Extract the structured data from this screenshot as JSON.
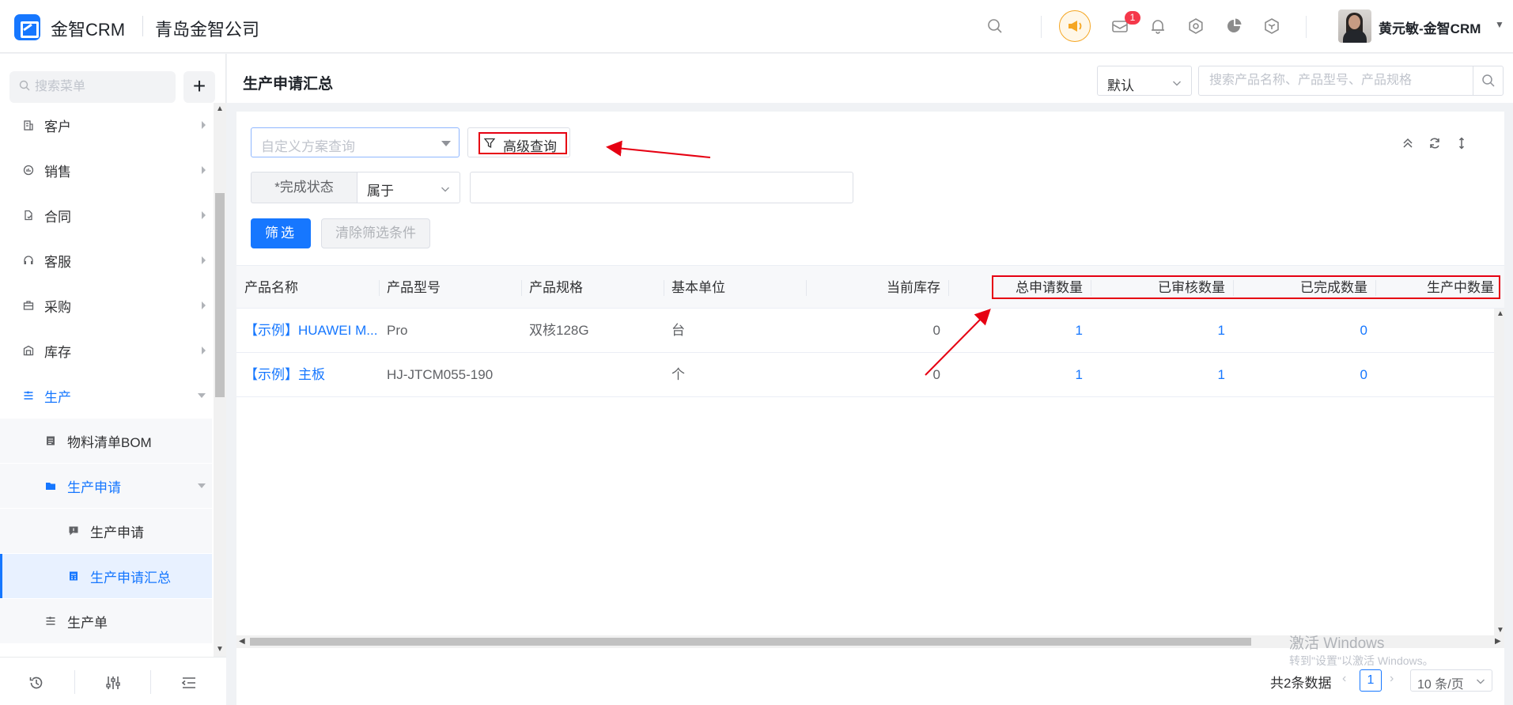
{
  "header": {
    "brand": "金智CRM",
    "company": "青岛金智公司",
    "message_badge": "1",
    "username": "黄元敏-金智CRM",
    "icons": [
      "search-icon",
      "speaker-icon",
      "message-icon",
      "bell-icon",
      "gear-icon",
      "pie-chart-icon",
      "cube-icon",
      "caret-down-icon"
    ],
    "colors": {
      "brand": "#1677ff",
      "speaker": "#f5a623",
      "badge": "#f5384a"
    }
  },
  "sidebar": {
    "search_placeholder": "搜索菜单",
    "add_label": "+",
    "items": [
      {
        "label": "客户",
        "icon": "building-icon"
      },
      {
        "label": "销售",
        "icon": "sales-icon"
      },
      {
        "label": "合同",
        "icon": "contract-icon"
      },
      {
        "label": "客服",
        "icon": "headset-icon"
      },
      {
        "label": "采购",
        "icon": "briefcase-icon"
      },
      {
        "label": "库存",
        "icon": "warehouse-icon"
      },
      {
        "label": "生产",
        "icon": "production-icon"
      },
      {
        "label": "物料清单BOM",
        "icon": "document-icon"
      },
      {
        "label": "生产申请",
        "icon": "folder-icon"
      },
      {
        "label": "生产申请",
        "icon": "request-icon"
      },
      {
        "label": "生产申请汇总",
        "icon": "summary-icon"
      },
      {
        "label": "生产单",
        "icon": "production-order-icon"
      }
    ],
    "footer_icons": [
      "history-icon",
      "settings-sliders-icon",
      "collapse-menu-icon"
    ]
  },
  "pagebar": {
    "title": "生产申请汇总",
    "view_select": "默认",
    "search_placeholder": "搜索产品名称、产品型号、产品规格"
  },
  "filters": {
    "scheme_placeholder": "自定义方案查询",
    "advanced_label": "高级查询",
    "condition_label": "*完成状态",
    "condition_operator": "属于",
    "condition_value": "",
    "filter_button": "筛选",
    "clear_button": "清除筛选条件"
  },
  "table": {
    "columns": [
      "产品名称",
      "产品型号",
      "产品规格",
      "基本单位",
      "当前库存",
      "总申请数量",
      "已审核数量",
      "已完成数量",
      "生产中数量"
    ],
    "rows": [
      {
        "name": "【示例】HUAWEI M...",
        "model": "Pro",
        "spec": "双核128G",
        "unit": "台",
        "stock": "0",
        "total": "1",
        "approved": "1",
        "completed": "0"
      },
      {
        "name": "【示例】主板",
        "model": "HJ-JTCM055-190",
        "spec": "",
        "unit": "个",
        "stock": "0",
        "total": "1",
        "approved": "1",
        "completed": "0"
      }
    ]
  },
  "pagination": {
    "total": "共2条数据",
    "current": "1",
    "page_size": "10 条/页"
  },
  "watermark": {
    "line1": "激活 Windows",
    "line2": "转到\"设置\"以激活 Windows。"
  },
  "annotations": {
    "color": "#e60012"
  }
}
